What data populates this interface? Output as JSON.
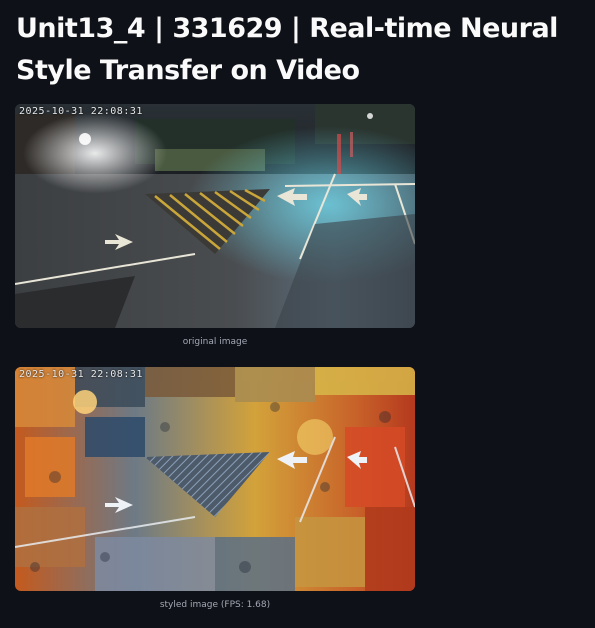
{
  "page": {
    "title": "Unit13_4 | 331629 | Real-time Neural Style Transfer on Video"
  },
  "images": {
    "original": {
      "timestamp": "2025-10-31 22:08:31",
      "caption": "original image"
    },
    "styled": {
      "timestamp": "2025-10-31 22:08:31",
      "caption": "styled image (FPS: 1.68)"
    }
  },
  "colors": {
    "background": "#0e1117",
    "title": "#fafafa",
    "caption": "#a3a8b4"
  }
}
